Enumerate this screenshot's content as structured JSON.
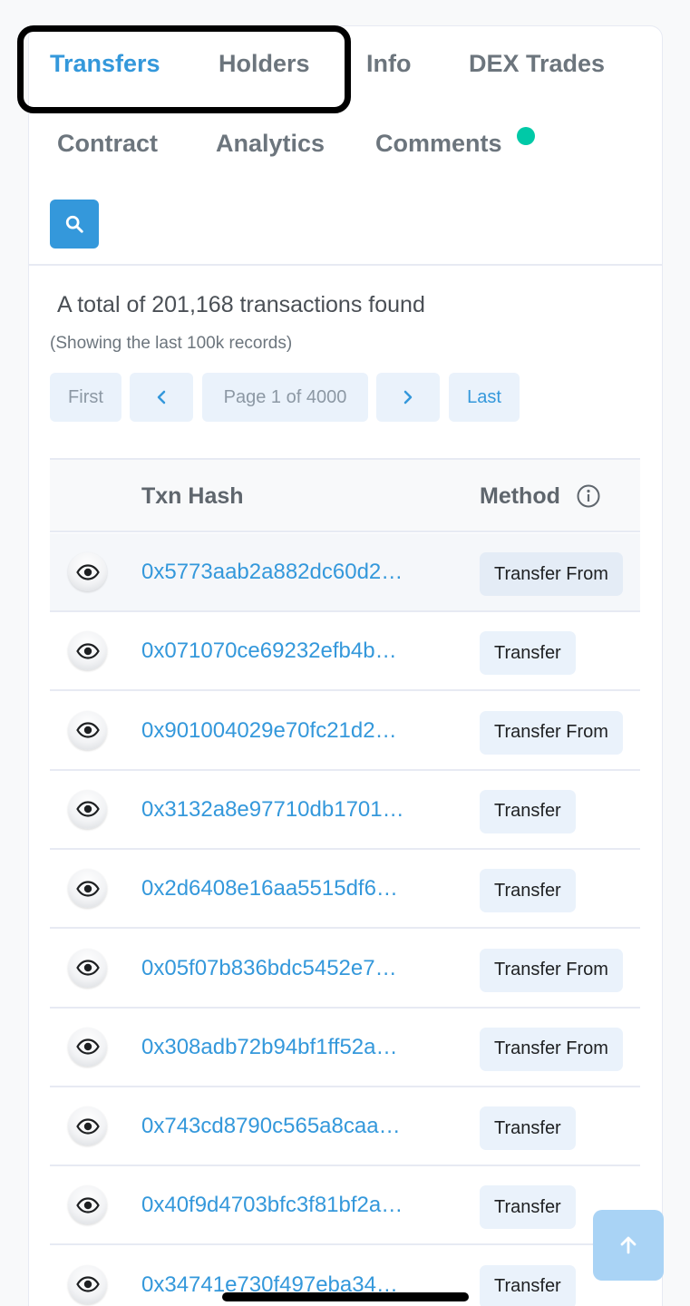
{
  "tabs": {
    "transfers": "Transfers",
    "holders": "Holders",
    "info": "Info",
    "dex_trades": "DEX Trades",
    "contract": "Contract",
    "analytics": "Analytics",
    "comments": "Comments"
  },
  "search": {
    "icon": "search-icon"
  },
  "summary": {
    "total_text": "A total of 201,168 transactions found",
    "showing_text": "(Showing the last 100k records)"
  },
  "pagination": {
    "first": "First",
    "prev": "‹",
    "page_info": "Page 1 of 4000",
    "next": "›",
    "last": "Last"
  },
  "table": {
    "headers": {
      "txn_hash": "Txn Hash",
      "method": "Method"
    },
    "rows": [
      {
        "hash": "0x5773aab2a882dc60d2…",
        "method": "Transfer From"
      },
      {
        "hash": "0x071070ce69232efb4b…",
        "method": "Transfer"
      },
      {
        "hash": "0x901004029e70fc21d2…",
        "method": "Transfer From"
      },
      {
        "hash": "0x3132a8e97710db1701…",
        "method": "Transfer"
      },
      {
        "hash": "0x2d6408e16aa5515df6…",
        "method": "Transfer"
      },
      {
        "hash": "0x05f07b836bdc5452e7…",
        "method": "Transfer From"
      },
      {
        "hash": "0x308adb72b94bf1ff52a…",
        "method": "Transfer From"
      },
      {
        "hash": "0x743cd8790c565a8caa…",
        "method": "Transfer"
      },
      {
        "hash": "0x40f9d4703bfc3f81bf2a…",
        "method": "Transfer"
      },
      {
        "hash": "0x34741e730f497eba34…",
        "method": "Transfer"
      }
    ]
  },
  "colors": {
    "accent": "#3498db",
    "notification_dot": "#00c9a7",
    "highlight_border": "#000000"
  }
}
